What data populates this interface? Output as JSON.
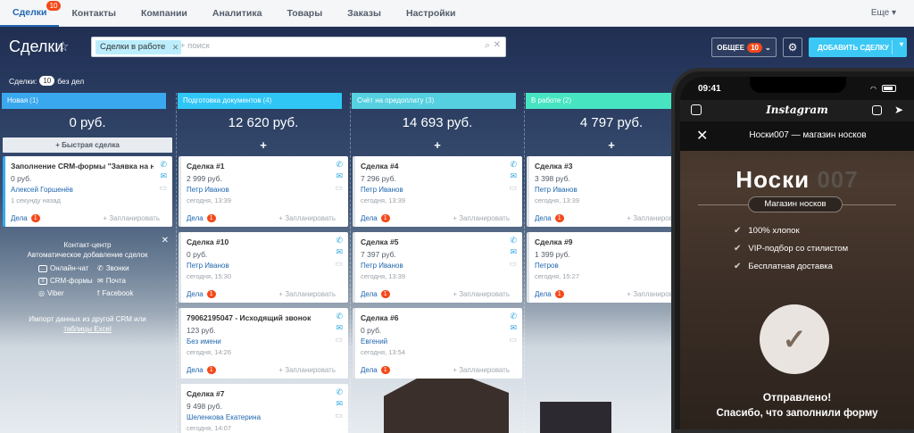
{
  "topnav": {
    "items": [
      {
        "label": "Сделки",
        "badge": "10"
      },
      {
        "label": "Контакты"
      },
      {
        "label": "Компании"
      },
      {
        "label": "Аналитика"
      },
      {
        "label": "Товары"
      },
      {
        "label": "Заказы"
      },
      {
        "label": "Настройки"
      }
    ],
    "more": "Еще"
  },
  "header": {
    "title": "Сделки",
    "filter_tag": "Сделки в работе",
    "search_placeholder": "+ поиск",
    "general_label": "ОБЩЕЕ",
    "general_badge": "10",
    "add_label": "ДОБАВИТЬ СДЕЛКУ"
  },
  "deals_info": {
    "prefix": "Сделки:",
    "count": "10",
    "suffix": "без дел"
  },
  "common": {
    "dela": "Дела",
    "plan": "+ Запланировать",
    "quick": "+ Быстрая сделка"
  },
  "columns": [
    {
      "name": "Новая",
      "count": "(1)",
      "color": "#39a8ef",
      "sum": "0 руб.",
      "cards": [
        {
          "title": "Заполнение CRM-формы \"Заявка на носки \"",
          "price": "0 руб.",
          "client": "Алексей Горшенёв",
          "time": "1 секунду назад",
          "dela": "1"
        }
      ]
    },
    {
      "name": "Подготовка документов",
      "count": "(4)",
      "color": "#2fc6f6",
      "sum": "12 620 руб.",
      "cards": [
        {
          "title": "Сделка #1",
          "price": "2 999 руб.",
          "client": "Петр Иванов",
          "time": "сегодня, 13:39",
          "dela": "1"
        },
        {
          "title": "Сделка #10",
          "price": "0 руб.",
          "client": "Петр Иванов",
          "time": "сегодня, 15:30",
          "dela": "1"
        },
        {
          "title": "79062195047 - Исходящий звонок",
          "price": "123 руб.",
          "client": "Без имени",
          "time": "сегодня, 14:26",
          "dela": "1"
        },
        {
          "title": "Сделка #7",
          "price": "9 498 руб.",
          "client": "Шеленкова Екатерина",
          "time": "сегодня, 14:07",
          "dela": "1"
        }
      ]
    },
    {
      "name": "Счёт на предоплату",
      "count": "(3)",
      "color": "#55d0e0",
      "sum": "14 693 руб.",
      "cards": [
        {
          "title": "Сделка #4",
          "price": "7 296 руб.",
          "client": "Петр Иванов",
          "time": "сегодня, 13:39",
          "dela": "1"
        },
        {
          "title": "Сделка #5",
          "price": "7 397 руб.",
          "client": "Петр Иванов",
          "time": "сегодня, 13:39",
          "dela": "1"
        },
        {
          "title": "Сделка #6",
          "price": "0 руб.",
          "client": "Евгений",
          "time": "сегодня, 13:54",
          "dela": "1"
        }
      ]
    },
    {
      "name": "В работе",
      "count": "(2)",
      "color": "#47e4c2",
      "sum": "4 797 руб.",
      "cards": [
        {
          "title": "Сделка #3",
          "price": "3 398 руб.",
          "client": "Петр Иванов",
          "time": "сегодня, 13:39",
          "dela": "1"
        },
        {
          "title": "Сделка #9",
          "price": "1 399 руб.",
          "client": "Петров",
          "time": "сегодня, 15:27",
          "dela": "1"
        }
      ]
    }
  ],
  "contact_center": {
    "title": "Контакт-центр",
    "subtitle": "Автоматическое добавление сделок",
    "items": [
      "Онлайн-чат",
      "Звонки",
      "CRM-формы",
      "Почта",
      "Viber",
      "Facebook"
    ],
    "import_line1": "Импорт данных из другой CRM или",
    "import_line2": "таблицы Excel"
  },
  "phone": {
    "time": "09:41",
    "app_title": "Instagram",
    "bar_title": "Носки007 — магазин носков",
    "brand_a": "Носки",
    "brand_b": "007",
    "subtitle": "Магазин носков",
    "features": [
      "100% хлопок",
      "VIP-подбор со стилистом",
      "Бесплатная доставка"
    ],
    "sent": "Отправлено!",
    "thanks": "Спасибо, что заполнили форму"
  }
}
